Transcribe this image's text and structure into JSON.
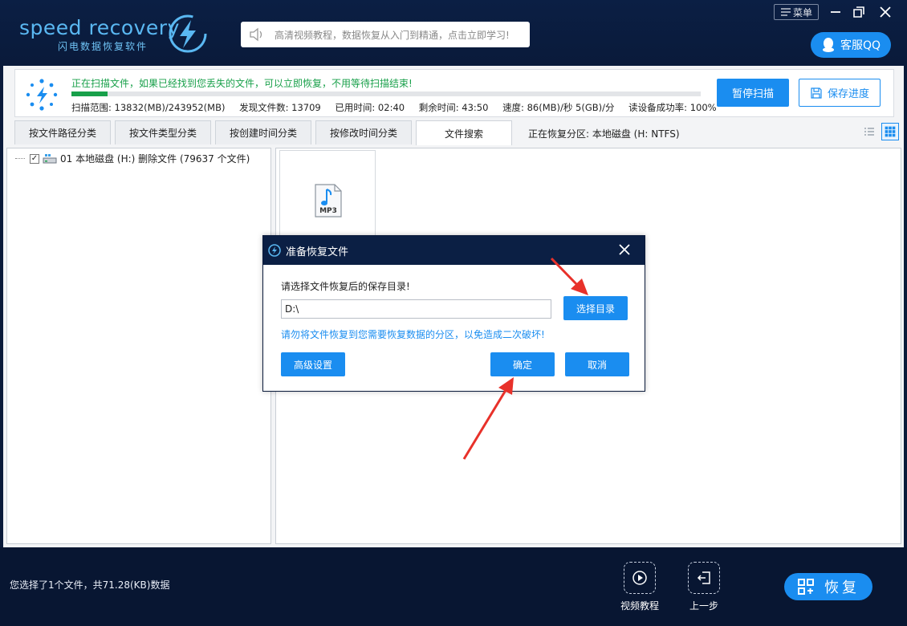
{
  "app": {
    "logo_text": "speed recovery",
    "logo_subtitle": "闪电数据恢复软件",
    "notice": "高清视频教程，数据恢复从入门到精通，点击立即学习!",
    "menu_label": "菜单",
    "qq_label": "客服QQ"
  },
  "scan": {
    "status": "正在扫描文件，如果已经找到您丢失的文件，可以立即恢复，不用等待扫描结束!",
    "progress": 0.057,
    "range": "扫描范围: 13832(MB)/243952(MB)",
    "found": "发现文件数: 13709",
    "elapsed": "已用时间: 02:40",
    "remaining": "剩余时间: 43:50",
    "speed": "速度: 86(MB)/秒  5(GB)/分",
    "read_success": "读设备成功率: 100%",
    "pause_label": "暂停扫描",
    "save_label": "保存进度"
  },
  "tabs": [
    {
      "label": "按文件路径分类"
    },
    {
      "label": "按文件类型分类"
    },
    {
      "label": "按创建时间分类"
    },
    {
      "label": "按修改时间分类"
    },
    {
      "label": "文件搜索"
    }
  ],
  "active_tab": 4,
  "partition_label": "正在恢复分区: 本地磁盘 (H: NTFS)",
  "tree": {
    "item_label": "01 本地磁盘 (H:) 删除文件  (79637 个文件)",
    "checked": true
  },
  "file": {
    "type_label": "MP3"
  },
  "dialog": {
    "title": "准备恢复文件",
    "prompt": "请选择文件恢复后的保存目录!",
    "path_value": "D:\\",
    "browse_label": "选择目录",
    "warning": "请勿将文件恢复到您需要恢复数据的分区，以免造成二次破坏!",
    "advanced_label": "高级设置",
    "ok_label": "确定",
    "cancel_label": "取消"
  },
  "bottom": {
    "selection_info": "您选择了1个文件，共71.28(KB)数据",
    "video_label": "视频教程",
    "back_label": "上一步",
    "recover_label": "恢复"
  },
  "colors": {
    "accent": "#1a8df0",
    "dark_bg": "#0a1a3a",
    "success": "#18a04a",
    "annotation": "#e8312a"
  }
}
